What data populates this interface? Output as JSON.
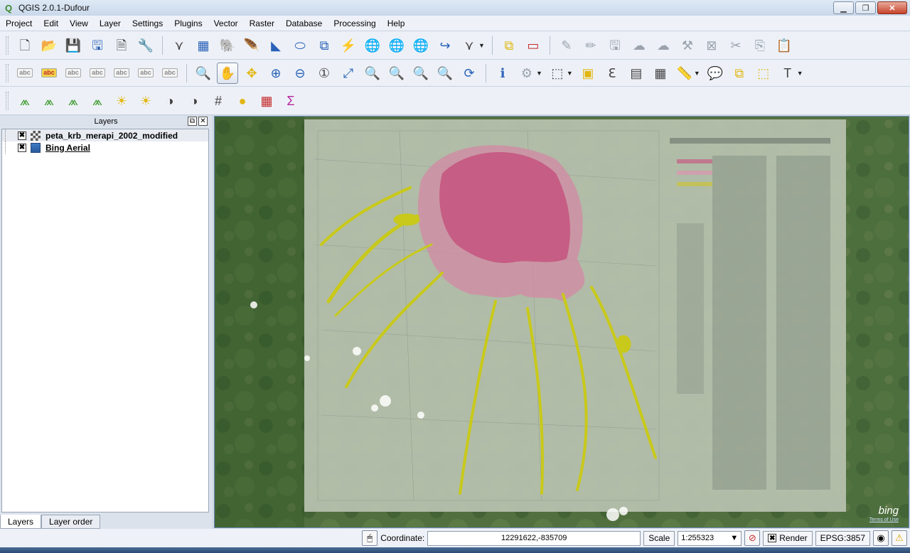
{
  "window": {
    "title": "QGIS 2.0.1-Dufour",
    "app_icon": "qgis-icon"
  },
  "menu": [
    "Project",
    "Edit",
    "View",
    "Layer",
    "Settings",
    "Plugins",
    "Vector",
    "Raster",
    "Database",
    "Processing",
    "Help"
  ],
  "toolbar1": [
    {
      "name": "new-project-icon",
      "glyph": "🗋",
      "cls": "c-dark"
    },
    {
      "name": "open-project-icon",
      "glyph": "📂",
      "cls": "c-orange"
    },
    {
      "name": "save-project-icon",
      "glyph": "💾",
      "cls": "c-blue"
    },
    {
      "name": "save-as-icon",
      "glyph": "🖫",
      "cls": "c-blue"
    },
    {
      "name": "new-print-composer-icon",
      "glyph": "🗎",
      "cls": "c-dark"
    },
    {
      "name": "composer-manager-icon",
      "glyph": "🔧",
      "cls": "c-dark"
    },
    {
      "name": "sep"
    },
    {
      "name": "add-vector-layer-icon",
      "glyph": "⋎",
      "cls": "c-dark"
    },
    {
      "name": "add-raster-layer-icon",
      "glyph": "▦",
      "cls": "c-blue"
    },
    {
      "name": "add-postgis-layer-icon",
      "glyph": "🐘",
      "cls": "c-blue"
    },
    {
      "name": "add-spatialite-layer-icon",
      "glyph": "🪶",
      "cls": "c-blue"
    },
    {
      "name": "add-mssql-layer-icon",
      "glyph": "◣",
      "cls": "c-blue"
    },
    {
      "name": "add-oracle-layer-icon",
      "glyph": "⬭",
      "cls": "c-blue"
    },
    {
      "name": "add-wms-layer-icon",
      "glyph": "⧉",
      "cls": "c-blue"
    },
    {
      "name": "add-wcs-layer-icon",
      "glyph": "⚡",
      "cls": "c-blue"
    },
    {
      "name": "add-wfs-layer-icon",
      "glyph": "🌐",
      "cls": "c-blue"
    },
    {
      "name": "add-delimited-text-icon",
      "glyph": "🌐",
      "cls": "c-teal"
    },
    {
      "name": "add-gpx-layer-icon",
      "glyph": "🌐",
      "cls": "c-blue"
    },
    {
      "name": "new-shapefile-icon",
      "glyph": "↪",
      "cls": "c-blue"
    },
    {
      "name": "new-spatialite-icon",
      "glyph": "⋎",
      "cls": "c-dark",
      "dropdown": true
    },
    {
      "name": "sep"
    },
    {
      "name": "add-feature-icon",
      "glyph": "⧉",
      "cls": "c-yellow"
    },
    {
      "name": "remove-layer-icon",
      "glyph": "▭",
      "cls": "c-red"
    },
    {
      "name": "sep"
    },
    {
      "name": "toggle-editing-icon",
      "glyph": "✎",
      "cls": "c-grey"
    },
    {
      "name": "edit-pencil-icon",
      "glyph": "✏",
      "cls": "c-grey"
    },
    {
      "name": "save-edits-icon",
      "glyph": "🖫",
      "cls": "c-grey"
    },
    {
      "name": "add-ring-icon",
      "glyph": "☁",
      "cls": "c-grey"
    },
    {
      "name": "move-feature-icon",
      "glyph": "☁",
      "cls": "c-grey"
    },
    {
      "name": "node-tool-icon",
      "glyph": "⚒",
      "cls": "c-grey"
    },
    {
      "name": "delete-selected-icon",
      "glyph": "⊠",
      "cls": "c-grey"
    },
    {
      "name": "cut-features-icon",
      "glyph": "✂",
      "cls": "c-grey"
    },
    {
      "name": "copy-features-icon",
      "glyph": "⎘",
      "cls": "c-grey"
    },
    {
      "name": "paste-features-icon",
      "glyph": "📋",
      "cls": "c-grey"
    }
  ],
  "toolbar2_labels": [
    {
      "name": "label-tool-icon",
      "text": "abc",
      "hi": false
    },
    {
      "name": "layer-labeling-icon",
      "text": "abc",
      "hi": true
    },
    {
      "name": "pin-labels-icon",
      "text": "abc",
      "hi": false
    },
    {
      "name": "show-hide-labels-icon",
      "text": "abc",
      "hi": false
    },
    {
      "name": "move-label-icon",
      "text": "abc",
      "hi": false
    },
    {
      "name": "rotate-label-icon",
      "text": "abc",
      "hi": false
    },
    {
      "name": "change-label-icon",
      "text": "abc",
      "hi": false
    }
  ],
  "toolbar2_nav": [
    {
      "name": "touch-zoom-icon",
      "glyph": "🔍",
      "cls": "c-dark"
    },
    {
      "name": "pan-map-icon",
      "glyph": "✋",
      "cls": "c-dark",
      "active": true
    },
    {
      "name": "pan-to-selection-icon",
      "glyph": "✥",
      "cls": "c-yellow"
    },
    {
      "name": "zoom-in-icon",
      "glyph": "⊕",
      "cls": "c-blue"
    },
    {
      "name": "zoom-out-icon",
      "glyph": "⊖",
      "cls": "c-blue"
    },
    {
      "name": "zoom-native-icon",
      "glyph": "①",
      "cls": "c-dark"
    },
    {
      "name": "zoom-full-icon",
      "glyph": "⤢",
      "cls": "c-blue"
    },
    {
      "name": "zoom-to-selection-icon",
      "glyph": "🔍",
      "cls": "c-yellow"
    },
    {
      "name": "zoom-to-layer-icon",
      "glyph": "🔍",
      "cls": "c-dark"
    },
    {
      "name": "zoom-last-icon",
      "glyph": "🔍",
      "cls": "c-blue"
    },
    {
      "name": "zoom-next-icon",
      "glyph": "🔍",
      "cls": "c-grey"
    },
    {
      "name": "refresh-icon",
      "glyph": "⟳",
      "cls": "c-blue"
    },
    {
      "name": "sep"
    },
    {
      "name": "identify-icon",
      "glyph": "ℹ",
      "cls": "c-blue"
    },
    {
      "name": "run-action-icon",
      "glyph": "⚙",
      "cls": "c-grey",
      "dropdown": true
    },
    {
      "name": "select-features-icon",
      "glyph": "⬚",
      "cls": "c-dark",
      "dropdown": true
    },
    {
      "name": "deselect-all-icon",
      "glyph": "▣",
      "cls": "c-yellow"
    },
    {
      "name": "field-calculator-icon",
      "glyph": "ℇ",
      "cls": "c-dark"
    },
    {
      "name": "attribute-table-icon",
      "glyph": "▤",
      "cls": "c-dark"
    },
    {
      "name": "statistics-icon",
      "glyph": "▦",
      "cls": "c-dark"
    },
    {
      "name": "measure-line-icon",
      "glyph": "📏",
      "cls": "c-dark",
      "dropdown": true
    },
    {
      "name": "map-tips-icon",
      "glyph": "💬",
      "cls": "c-yellow"
    },
    {
      "name": "new-bookmark-icon",
      "glyph": "⧉",
      "cls": "c-yellow"
    },
    {
      "name": "show-bookmarks-icon",
      "glyph": "⬚",
      "cls": "c-yellow"
    },
    {
      "name": "text-annotation-icon",
      "glyph": "T",
      "cls": "c-dark",
      "dropdown": true
    }
  ],
  "toolbar3": [
    {
      "name": "raster-histogram-icon",
      "glyph": "⩕",
      "cls": "c-green"
    },
    {
      "name": "raster-stretch-icon",
      "glyph": "⩕",
      "cls": "c-green"
    },
    {
      "name": "local-histogram-icon",
      "glyph": "⩕",
      "cls": "c-green"
    },
    {
      "name": "full-stretch-icon",
      "glyph": "⩕",
      "cls": "c-green"
    },
    {
      "name": "increase-brightness-icon",
      "glyph": "☀",
      "cls": "c-yellow"
    },
    {
      "name": "decrease-brightness-icon",
      "glyph": "☀",
      "cls": "c-yellow"
    },
    {
      "name": "increase-contrast-icon",
      "glyph": "◑",
      "cls": "c-dark"
    },
    {
      "name": "decrease-contrast-icon",
      "glyph": "◑",
      "cls": "c-dark"
    },
    {
      "name": "coordinate-grid-icon",
      "glyph": "#",
      "cls": "c-dark"
    },
    {
      "name": "transparency-icon",
      "glyph": "●",
      "cls": "c-yellow"
    },
    {
      "name": "raster-calculator-icon",
      "glyph": "▦",
      "cls": "c-red"
    },
    {
      "name": "zonal-statistics-icon",
      "glyph": "Σ",
      "cls": "c-purple"
    }
  ],
  "layers_panel": {
    "title": "Layers",
    "float_symbol": "⧉",
    "close_symbol": "✕",
    "layers": [
      {
        "name": "peta_krb_merapi_2002_modified",
        "type": "raster",
        "checked": "✖",
        "underline": false
      },
      {
        "name": "Bing Aerial",
        "type": "wms",
        "checked": "✖",
        "underline": true
      }
    ],
    "tabs": [
      "Layers",
      "Layer order"
    ]
  },
  "map": {
    "attribution": "bing",
    "attribution_sub": "Terms of Use"
  },
  "status": {
    "coordinate_label": "Coordinate:",
    "coordinate_value": "12291622,-835709",
    "scale_label": "Scale",
    "scale_value": "1:255323",
    "render_label": "Render",
    "render_checked": "✖",
    "crs": "EPSG:3857"
  }
}
